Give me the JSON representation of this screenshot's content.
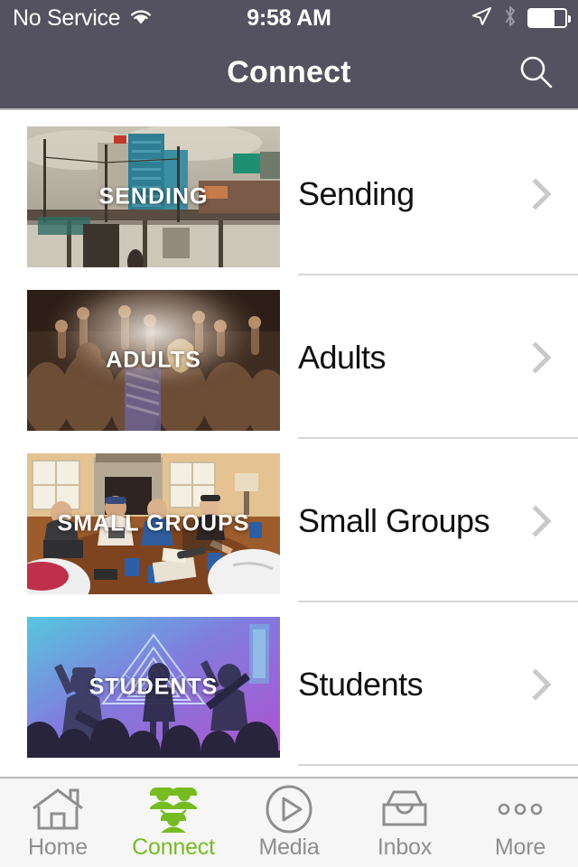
{
  "status_bar": {
    "carrier": "No Service",
    "wifi_icon": "wifi-icon",
    "time": "9:58 AM",
    "location_icon": "location-arrow-icon",
    "bluetooth_icon": "bluetooth-icon",
    "battery_icon": "battery-icon",
    "battery_level_percent": 70
  },
  "navbar": {
    "title": "Connect",
    "search_icon": "search-icon"
  },
  "list": {
    "rows": [
      {
        "label": "Sending",
        "thumbnail_caption": "SENDING",
        "thumbnail_desc": "city-skyline-photo",
        "chevron_icon": "chevron-right-icon"
      },
      {
        "label": "Adults",
        "thumbnail_caption": "ADULTS",
        "thumbnail_desc": "worship-crowd-photo",
        "chevron_icon": "chevron-right-icon"
      },
      {
        "label": "Small Groups",
        "thumbnail_caption": "SMALL GROUPS",
        "thumbnail_desc": "living-room-gathering-photo",
        "chevron_icon": "chevron-right-icon"
      },
      {
        "label": "Students",
        "thumbnail_caption": "STUDENTS",
        "thumbnail_desc": "concert-stage-photo",
        "chevron_icon": "chevron-right-icon"
      }
    ]
  },
  "tabbar": {
    "active": "Connect",
    "accent_color": "#76bc21",
    "inactive_color": "#8e8e8e",
    "items": [
      {
        "label": "Home",
        "icon": "home-icon"
      },
      {
        "label": "Connect",
        "icon": "people-group-icon"
      },
      {
        "label": "Media",
        "icon": "play-circle-icon"
      },
      {
        "label": "Inbox",
        "icon": "inbox-tray-icon"
      },
      {
        "label": "More",
        "icon": "ellipsis-icon"
      }
    ]
  },
  "colors": {
    "header_bg": "#545260",
    "tabbar_bg": "#f6f6f6",
    "separator": "#d6d6d6",
    "label_text": "#111111",
    "accent": "#76bc21"
  }
}
